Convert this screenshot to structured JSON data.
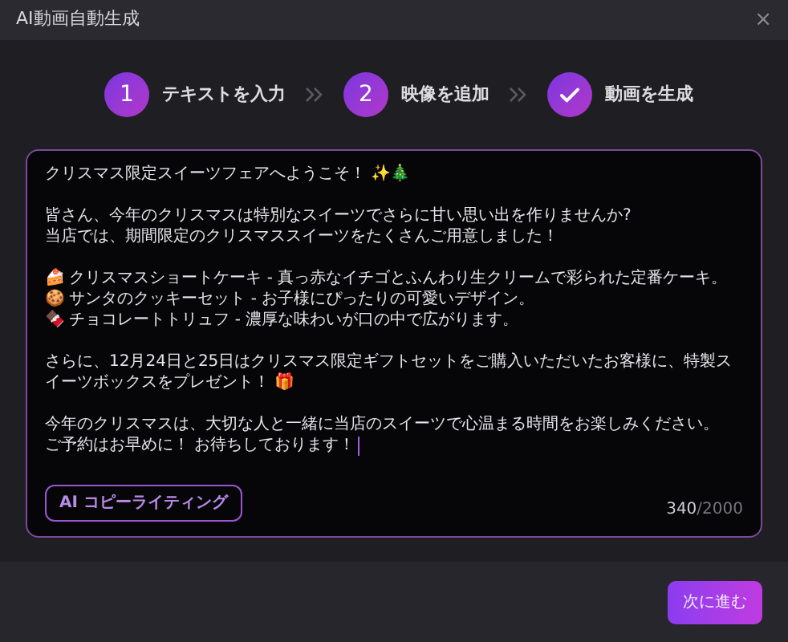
{
  "window": {
    "title": "AI動画自動生成",
    "close": "×"
  },
  "steps": [
    {
      "number": "1",
      "label": "テキストを入力",
      "kind": "number"
    },
    {
      "number": "2",
      "label": "映像を追加",
      "kind": "number"
    },
    {
      "label": "動画を生成",
      "kind": "done"
    }
  ],
  "editor": {
    "paragraphs": [
      [
        "クリスマス限定スイーツフェアへようこそ！ ✨🎄"
      ],
      [
        "皆さん、今年のクリスマスは特別なスイーツでさらに甘い思い出を作りませんか?",
        "当店では、期間限定のクリスマススイーツをたくさんご用意しました！"
      ],
      [
        "🍰 クリスマスショートケーキ - 真っ赤なイチゴとふんわり生クリームで彩られた定番ケーキ。",
        "🍪 サンタのクッキーセット - お子様にぴったりの可愛いデザイン。",
        "🍫 チョコレートトリュフ - 濃厚な味わいが口の中で広がります。"
      ],
      [
        "さらに、12月24日と25日はクリスマス限定ギフトセットをご購入いただいたお客様に、特製スイーツボックスをプレゼント！ 🎁"
      ],
      [
        "今年のクリスマスは、大切な人と一緒に当店のスイーツで心温まる時間をお楽しみください。",
        "ご予約はお早めに！ お待ちしております！"
      ]
    ],
    "ai_button": "AI コピーライティング",
    "count": "340",
    "max": "/2000"
  },
  "next_button": "次に進む"
}
